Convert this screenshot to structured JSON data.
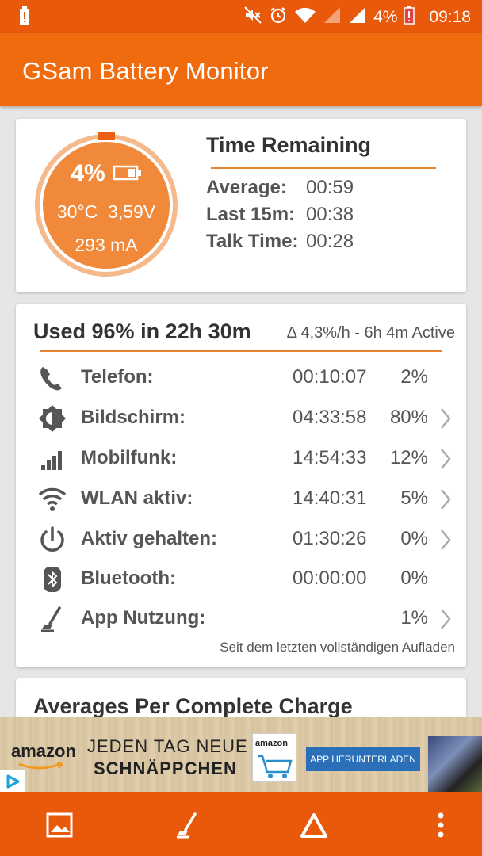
{
  "status_bar": {
    "battery_percent": "4%",
    "time": "09:18"
  },
  "app_bar": {
    "title": "GSam Battery Monitor"
  },
  "battery_gauge": {
    "level_fraction": 0.04,
    "percent": "4%",
    "temperature": "30°C",
    "voltage": "3,59V",
    "current": "293 mA"
  },
  "time_remaining": {
    "title": "Time Remaining",
    "rows": [
      {
        "label": "Average:",
        "value": "00:59"
      },
      {
        "label": "Last 15m:",
        "value": "00:38"
      },
      {
        "label": "Talk Time:",
        "value": "00:28"
      }
    ]
  },
  "usage": {
    "title": "Used 96% in 22h 30m",
    "delta": "Δ 4,3%/h - 6h 4m Active",
    "rows": [
      {
        "icon": "phone-icon",
        "name": "Telefon:",
        "duration": "00:10:07",
        "percent": "2%",
        "has_chevron": false
      },
      {
        "icon": "brightness-icon",
        "name": "Bildschirm:",
        "duration": "04:33:58",
        "percent": "80%",
        "has_chevron": true
      },
      {
        "icon": "signal-bars-icon",
        "name": "Mobilfunk:",
        "duration": "14:54:33",
        "percent": "12%",
        "has_chevron": true
      },
      {
        "icon": "wifi-icon",
        "name": "WLAN aktiv:",
        "duration": "14:40:31",
        "percent": "5%",
        "has_chevron": true
      },
      {
        "icon": "power-icon",
        "name": "Aktiv gehalten:",
        "duration": "01:30:26",
        "percent": "0%",
        "has_chevron": true
      },
      {
        "icon": "bluetooth-icon",
        "name": "Bluetooth:",
        "duration": "00:00:00",
        "percent": "0%",
        "has_chevron": false
      },
      {
        "icon": "app-usage-icon",
        "name": "App Nutzung:",
        "duration": "",
        "percent": "1%",
        "has_chevron": true
      }
    ],
    "footnote": "Seit dem letzten vollständigen Aufladen"
  },
  "averages": {
    "title": "Averages Per Complete Charge"
  },
  "ad": {
    "brand": "amazon",
    "line1": "JEDEN TAG NEUE",
    "line2": "SCHNÄPPCHEN",
    "logo_label": "amazon",
    "button": "APP HERUNTERLADEN"
  },
  "bottom_nav": {
    "items": [
      "image-icon",
      "app-usage-icon",
      "delta-icon",
      "more-vert-icon"
    ]
  },
  "colors": {
    "status_bar": "#e8590c",
    "app_bar": "#f06a0e",
    "gauge_fill": "#f08a3a",
    "accent_line": "#e8832f"
  }
}
